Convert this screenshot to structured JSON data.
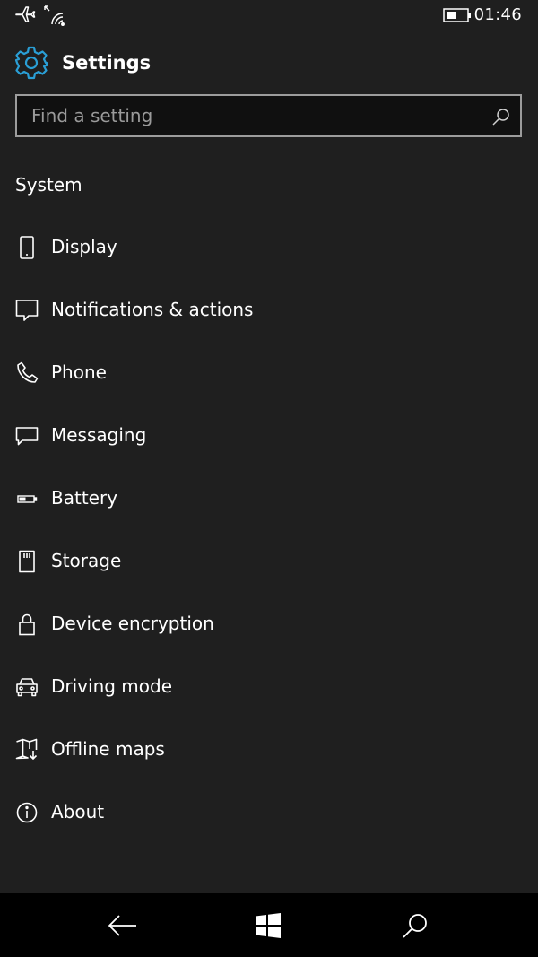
{
  "status": {
    "time": "01:46",
    "icons": [
      "airplane-icon",
      "wifi-icon",
      "battery-icon"
    ]
  },
  "header": {
    "title": "Settings",
    "icon": "gear-icon",
    "accent": "#2a9fd6"
  },
  "search": {
    "placeholder": "Find a setting",
    "value": ""
  },
  "section": {
    "title": "System"
  },
  "items": [
    {
      "label": "Display",
      "icon": "phone-display-icon"
    },
    {
      "label": "Notifications & actions",
      "icon": "notification-icon"
    },
    {
      "label": "Phone",
      "icon": "phone-icon"
    },
    {
      "label": "Messaging",
      "icon": "message-icon"
    },
    {
      "label": "Battery",
      "icon": "battery-icon"
    },
    {
      "label": "Storage",
      "icon": "storage-icon"
    },
    {
      "label": "Device encryption",
      "icon": "lock-icon"
    },
    {
      "label": "Driving mode",
      "icon": "car-icon"
    },
    {
      "label": "Offline maps",
      "icon": "map-download-icon"
    },
    {
      "label": "About",
      "icon": "info-icon"
    }
  ],
  "navbar": {
    "buttons": [
      "back-icon",
      "windows-icon",
      "search-icon"
    ]
  }
}
